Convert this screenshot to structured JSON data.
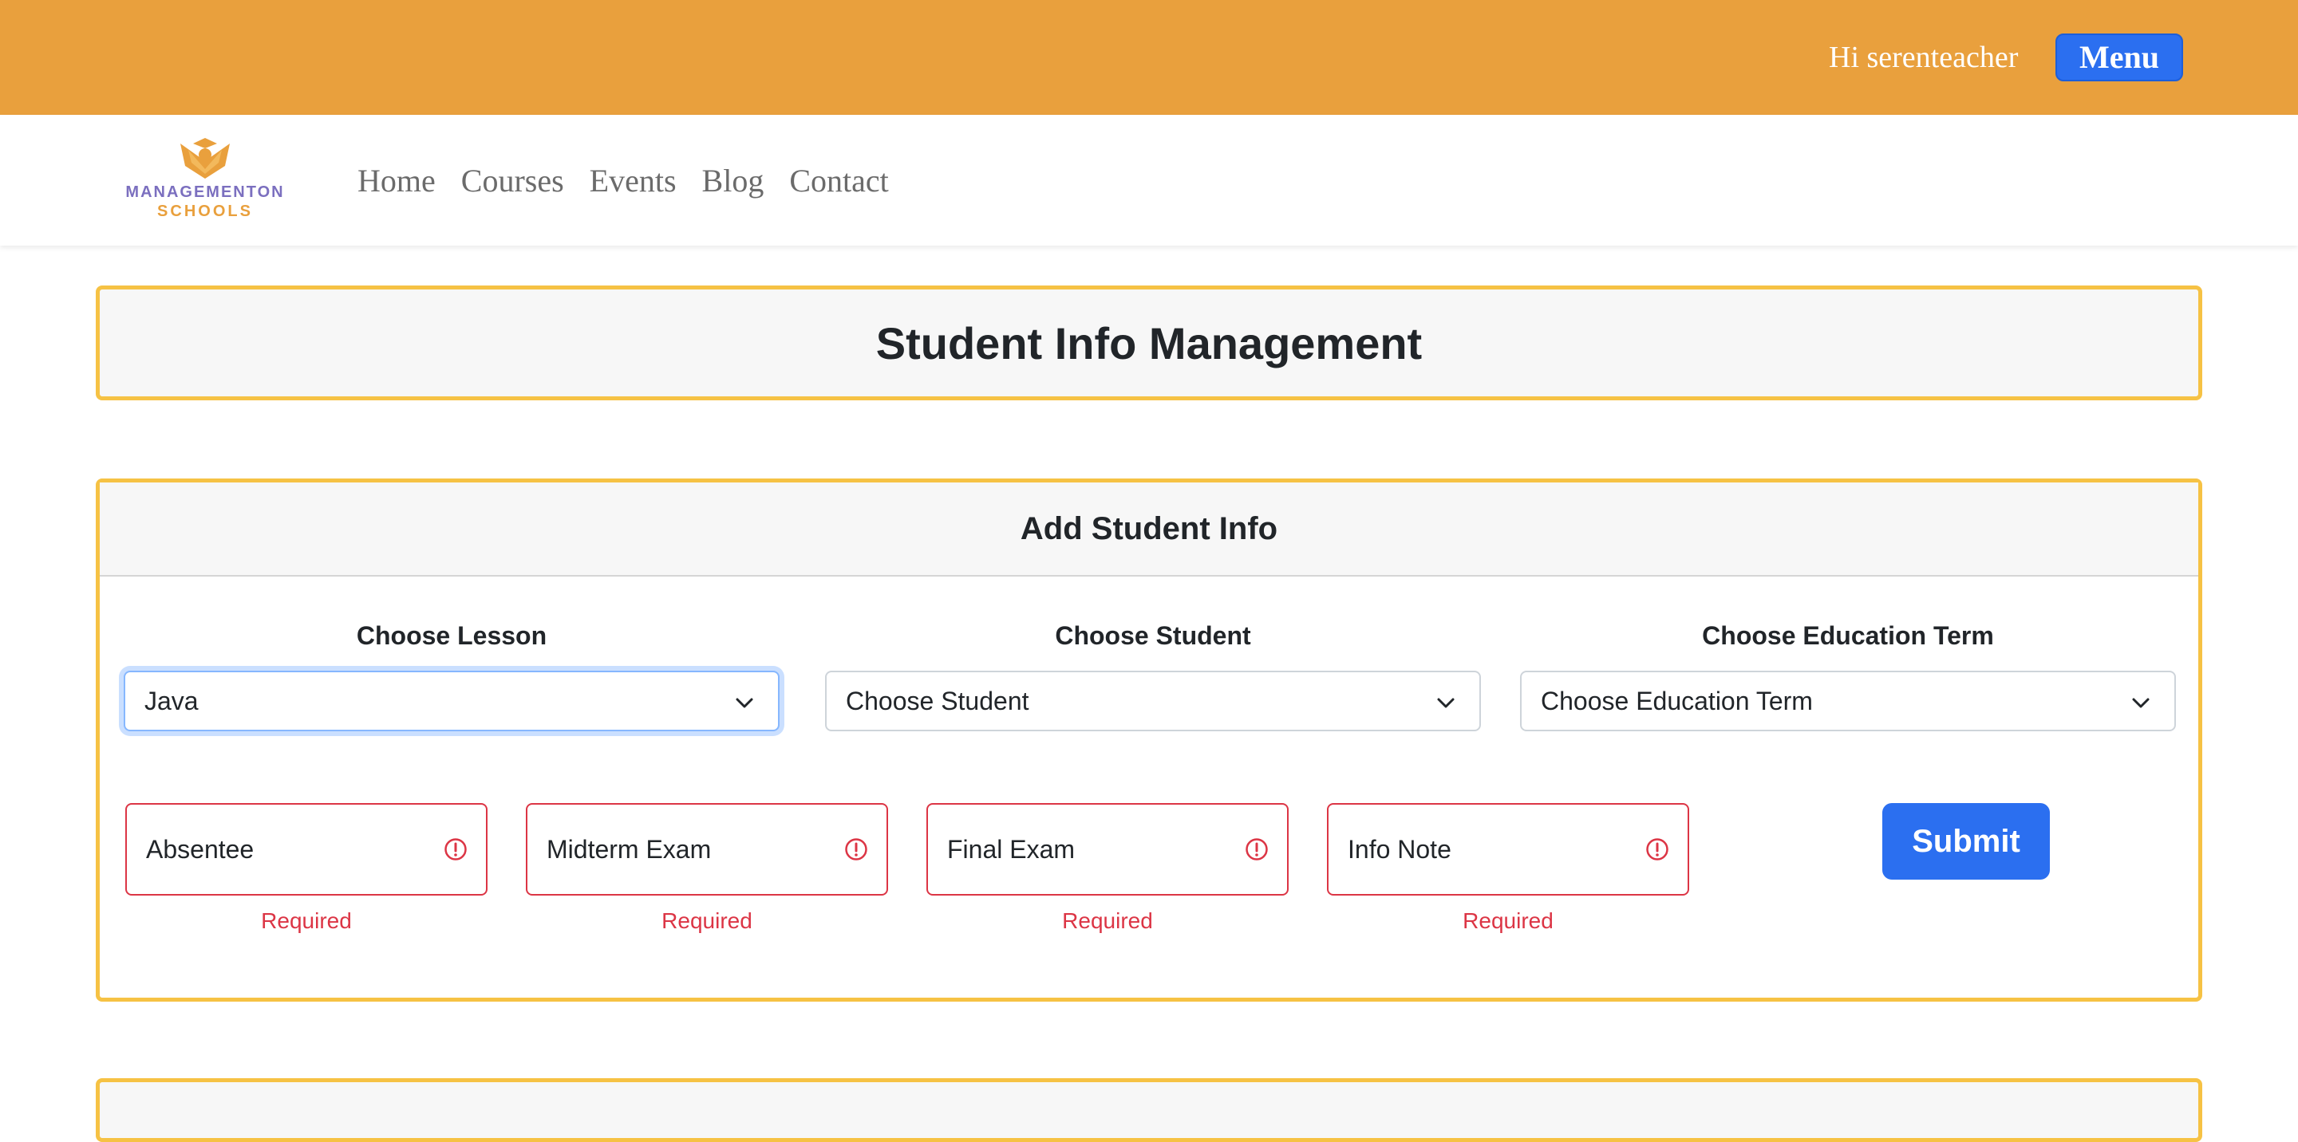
{
  "topbar": {
    "greeting": "Hi serenteacher",
    "menu_label": "Menu",
    "color": "#e9a03d"
  },
  "brand": {
    "line1": "MANAGEMENTON",
    "line2": "SCHOOLS",
    "logo_icon": "graduate-book-logo"
  },
  "nav": {
    "items": [
      "Home",
      "Courses",
      "Events",
      "Blog",
      "Contact"
    ]
  },
  "page_title": "Student Info Management",
  "form": {
    "title": "Add Student Info",
    "selects": [
      {
        "label": "Choose Lesson",
        "value": "Java"
      },
      {
        "label": "Choose Student",
        "value": "Choose Student"
      },
      {
        "label": "Choose Education Term",
        "value": "Choose Education Term"
      }
    ],
    "inputs": [
      {
        "placeholder": "Absentee",
        "error": "Required"
      },
      {
        "placeholder": "Midterm Exam",
        "error": "Required"
      },
      {
        "placeholder": "Final Exam",
        "error": "Required"
      },
      {
        "placeholder": "Info Note",
        "error": "Required"
      }
    ],
    "submit_label": "Submit"
  },
  "colors": {
    "accent": "#2b6ff0",
    "card_border": "#f6c244",
    "error": "#dc3545"
  }
}
